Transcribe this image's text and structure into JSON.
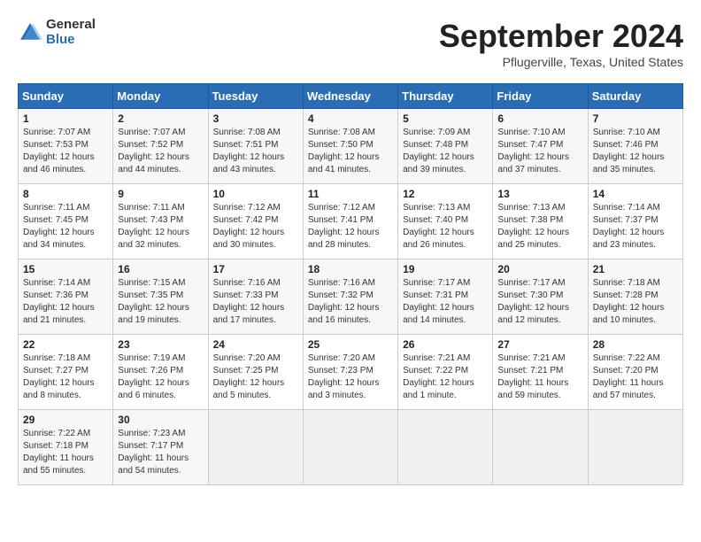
{
  "header": {
    "logo_general": "General",
    "logo_blue": "Blue",
    "title": "September 2024",
    "location": "Pflugerville, Texas, United States"
  },
  "days_of_week": [
    "Sunday",
    "Monday",
    "Tuesday",
    "Wednesday",
    "Thursday",
    "Friday",
    "Saturday"
  ],
  "weeks": [
    [
      {
        "day": "1",
        "sunrise": "Sunrise: 7:07 AM",
        "sunset": "Sunset: 7:53 PM",
        "daylight": "Daylight: 12 hours and 46 minutes."
      },
      {
        "day": "2",
        "sunrise": "Sunrise: 7:07 AM",
        "sunset": "Sunset: 7:52 PM",
        "daylight": "Daylight: 12 hours and 44 minutes."
      },
      {
        "day": "3",
        "sunrise": "Sunrise: 7:08 AM",
        "sunset": "Sunset: 7:51 PM",
        "daylight": "Daylight: 12 hours and 43 minutes."
      },
      {
        "day": "4",
        "sunrise": "Sunrise: 7:08 AM",
        "sunset": "Sunset: 7:50 PM",
        "daylight": "Daylight: 12 hours and 41 minutes."
      },
      {
        "day": "5",
        "sunrise": "Sunrise: 7:09 AM",
        "sunset": "Sunset: 7:48 PM",
        "daylight": "Daylight: 12 hours and 39 minutes."
      },
      {
        "day": "6",
        "sunrise": "Sunrise: 7:10 AM",
        "sunset": "Sunset: 7:47 PM",
        "daylight": "Daylight: 12 hours and 37 minutes."
      },
      {
        "day": "7",
        "sunrise": "Sunrise: 7:10 AM",
        "sunset": "Sunset: 7:46 PM",
        "daylight": "Daylight: 12 hours and 35 minutes."
      }
    ],
    [
      {
        "day": "8",
        "sunrise": "Sunrise: 7:11 AM",
        "sunset": "Sunset: 7:45 PM",
        "daylight": "Daylight: 12 hours and 34 minutes."
      },
      {
        "day": "9",
        "sunrise": "Sunrise: 7:11 AM",
        "sunset": "Sunset: 7:43 PM",
        "daylight": "Daylight: 12 hours and 32 minutes."
      },
      {
        "day": "10",
        "sunrise": "Sunrise: 7:12 AM",
        "sunset": "Sunset: 7:42 PM",
        "daylight": "Daylight: 12 hours and 30 minutes."
      },
      {
        "day": "11",
        "sunrise": "Sunrise: 7:12 AM",
        "sunset": "Sunset: 7:41 PM",
        "daylight": "Daylight: 12 hours and 28 minutes."
      },
      {
        "day": "12",
        "sunrise": "Sunrise: 7:13 AM",
        "sunset": "Sunset: 7:40 PM",
        "daylight": "Daylight: 12 hours and 26 minutes."
      },
      {
        "day": "13",
        "sunrise": "Sunrise: 7:13 AM",
        "sunset": "Sunset: 7:38 PM",
        "daylight": "Daylight: 12 hours and 25 minutes."
      },
      {
        "day": "14",
        "sunrise": "Sunrise: 7:14 AM",
        "sunset": "Sunset: 7:37 PM",
        "daylight": "Daylight: 12 hours and 23 minutes."
      }
    ],
    [
      {
        "day": "15",
        "sunrise": "Sunrise: 7:14 AM",
        "sunset": "Sunset: 7:36 PM",
        "daylight": "Daylight: 12 hours and 21 minutes."
      },
      {
        "day": "16",
        "sunrise": "Sunrise: 7:15 AM",
        "sunset": "Sunset: 7:35 PM",
        "daylight": "Daylight: 12 hours and 19 minutes."
      },
      {
        "day": "17",
        "sunrise": "Sunrise: 7:16 AM",
        "sunset": "Sunset: 7:33 PM",
        "daylight": "Daylight: 12 hours and 17 minutes."
      },
      {
        "day": "18",
        "sunrise": "Sunrise: 7:16 AM",
        "sunset": "Sunset: 7:32 PM",
        "daylight": "Daylight: 12 hours and 16 minutes."
      },
      {
        "day": "19",
        "sunrise": "Sunrise: 7:17 AM",
        "sunset": "Sunset: 7:31 PM",
        "daylight": "Daylight: 12 hours and 14 minutes."
      },
      {
        "day": "20",
        "sunrise": "Sunrise: 7:17 AM",
        "sunset": "Sunset: 7:30 PM",
        "daylight": "Daylight: 12 hours and 12 minutes."
      },
      {
        "day": "21",
        "sunrise": "Sunrise: 7:18 AM",
        "sunset": "Sunset: 7:28 PM",
        "daylight": "Daylight: 12 hours and 10 minutes."
      }
    ],
    [
      {
        "day": "22",
        "sunrise": "Sunrise: 7:18 AM",
        "sunset": "Sunset: 7:27 PM",
        "daylight": "Daylight: 12 hours and 8 minutes."
      },
      {
        "day": "23",
        "sunrise": "Sunrise: 7:19 AM",
        "sunset": "Sunset: 7:26 PM",
        "daylight": "Daylight: 12 hours and 6 minutes."
      },
      {
        "day": "24",
        "sunrise": "Sunrise: 7:20 AM",
        "sunset": "Sunset: 7:25 PM",
        "daylight": "Daylight: 12 hours and 5 minutes."
      },
      {
        "day": "25",
        "sunrise": "Sunrise: 7:20 AM",
        "sunset": "Sunset: 7:23 PM",
        "daylight": "Daylight: 12 hours and 3 minutes."
      },
      {
        "day": "26",
        "sunrise": "Sunrise: 7:21 AM",
        "sunset": "Sunset: 7:22 PM",
        "daylight": "Daylight: 12 hours and 1 minute."
      },
      {
        "day": "27",
        "sunrise": "Sunrise: 7:21 AM",
        "sunset": "Sunset: 7:21 PM",
        "daylight": "Daylight: 11 hours and 59 minutes."
      },
      {
        "day": "28",
        "sunrise": "Sunrise: 7:22 AM",
        "sunset": "Sunset: 7:20 PM",
        "daylight": "Daylight: 11 hours and 57 minutes."
      }
    ],
    [
      {
        "day": "29",
        "sunrise": "Sunrise: 7:22 AM",
        "sunset": "Sunset: 7:18 PM",
        "daylight": "Daylight: 11 hours and 55 minutes."
      },
      {
        "day": "30",
        "sunrise": "Sunrise: 7:23 AM",
        "sunset": "Sunset: 7:17 PM",
        "daylight": "Daylight: 11 hours and 54 minutes."
      },
      null,
      null,
      null,
      null,
      null
    ]
  ]
}
